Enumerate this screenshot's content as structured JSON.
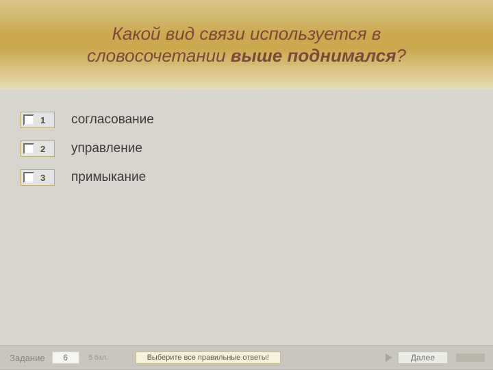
{
  "header": {
    "line1": "Какой вид связи используется в",
    "line2_plain": "словосочетании  ",
    "line2_bold": "выше поднимался",
    "line2_qmark": "?"
  },
  "options": [
    {
      "num": "1",
      "label": "согласование"
    },
    {
      "num": "2",
      "label": "управление"
    },
    {
      "num": "3",
      "label": "примыкание"
    }
  ],
  "footer": {
    "task_label": "Задание",
    "question_number": "6",
    "points": "5 бал.",
    "hint": "Выберите все правильные ответы!",
    "next": "Далее"
  }
}
